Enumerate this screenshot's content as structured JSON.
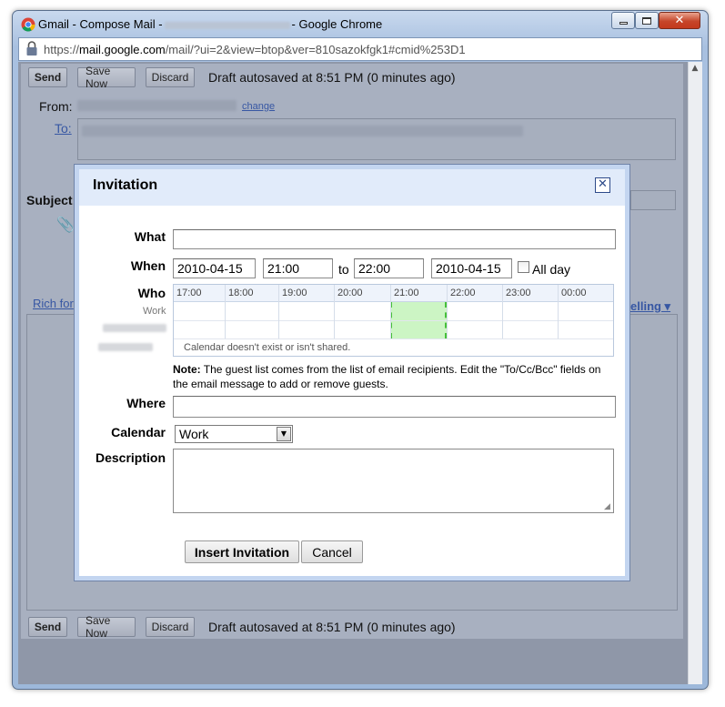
{
  "window": {
    "title_prefix": "Gmail - Compose Mail -",
    "title_suffix": "- Google Chrome",
    "close_glyph": "✕",
    "min_glyph": "—",
    "max_glyph": "☐"
  },
  "address_bar": {
    "scheme": "https://",
    "host": "mail.google.com",
    "path": "/mail/?ui=2&view=btop&ver=810sazokfgk1#cmid%253D1"
  },
  "compose": {
    "send_label": "Send",
    "save_now_label": "Save Now",
    "discard_label": "Discard",
    "status_text": "Draft autosaved at 8:51 PM (0 minutes ago)",
    "from_label": "From:",
    "change_link": "change",
    "to_label": "To:",
    "subject_label": "Subject:",
    "rich_link": "Rich for",
    "spelling_link": "elling ▾"
  },
  "dialog": {
    "title": "Invitation",
    "close_glyph": "✕",
    "what_label": "What",
    "what_value": "",
    "when_label": "When",
    "start_date": "2010-04-15",
    "start_time": "21:00",
    "to_text": "to",
    "end_time": "22:00",
    "end_date": "2010-04-15",
    "all_day_label": "All day",
    "all_day_checked": false,
    "who_label": "Who",
    "grid_hours": [
      "17:00",
      "18:00",
      "19:00",
      "20:00",
      "21:00",
      "22:00",
      "23:00",
      "00:00"
    ],
    "grid_row_label": "Work",
    "grid_message": "Calendar doesn't exist or isn't shared.",
    "note_bold": "Note:",
    "note_text": " The guest list comes from the list of email recipients. Edit the \"To/Cc/Bcc\" fields on the email message to add or remove guests.",
    "where_label": "Where",
    "where_value": "",
    "calendar_label": "Calendar",
    "calendar_value": "Work",
    "description_label": "Description",
    "insert_button": "Insert Invitation",
    "cancel_button": "Cancel"
  },
  "colors": {
    "dialog_header": "#e1ebfa",
    "busy_slot": "#ccf5c4",
    "link": "#3757a3"
  }
}
